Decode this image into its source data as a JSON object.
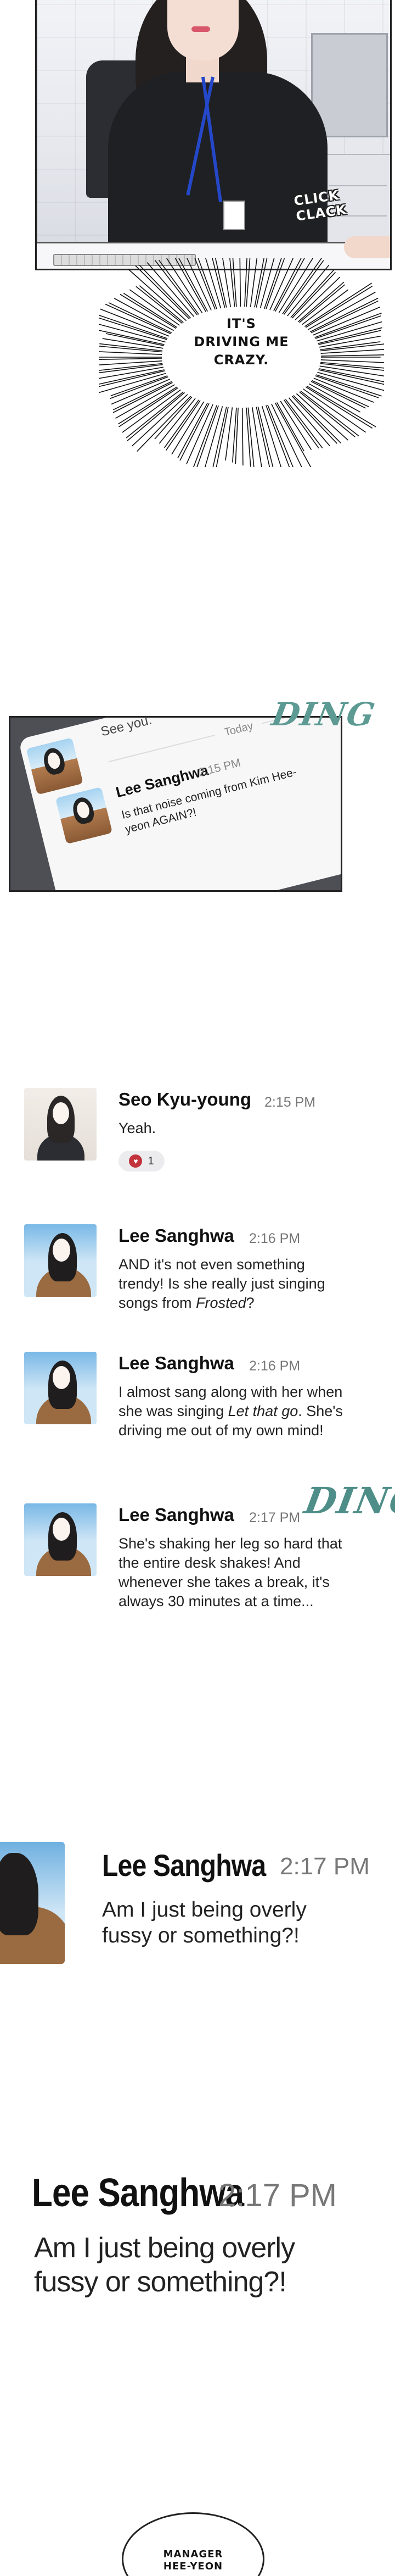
{
  "panel1": {
    "sfx": "CLICK CLACK"
  },
  "burst_bubble": {
    "line1": "IT'S",
    "line2": "DRIVING ME",
    "line3": "CRAZY."
  },
  "phone_panel": {
    "see_you": "See you.",
    "today": "Today",
    "sender": "Lee Sanghwa",
    "time": "2:15 PM",
    "message": "Is that noise coming from Kim Hee-yeon AGAIN?!",
    "sfx": "DING"
  },
  "chat": {
    "messages": [
      {
        "name": "Seo Kyu-young",
        "time": "2:15 PM",
        "text": "Yeah.",
        "reaction_count": "1"
      },
      {
        "name": "Lee Sanghwa",
        "time": "2:16 PM",
        "text_pre": "AND it's not even something trendy! Is she really just singing songs from ",
        "text_em": "Frosted",
        "text_post": "?"
      },
      {
        "name": "Lee Sanghwa",
        "time": "2:16 PM",
        "text_pre": "I almost sang along with her when she was singing ",
        "text_em": "Let that go",
        "text_post": ". She's driving me out of my own mind!"
      },
      {
        "name": "Lee Sanghwa",
        "time": "2:17 PM",
        "text": "She's shaking her leg so hard that the entire desk shakes! And whenever she takes a break, it's always 30 minutes at a time..."
      }
    ],
    "sfx": "DING"
  },
  "zoom_panel_1": {
    "name": "Lee Sanghwa",
    "time": "2:17 PM",
    "message": "Am I just being overly fussy or something?!"
  },
  "zoom_panel_2": {
    "name": "Lee Sanghwa",
    "time": "2:17 PM",
    "message": "Am I just being overly fussy or something?!"
  },
  "bottom_bubble": {
    "line1": "MANAGER",
    "line2": "HEE-YEON"
  },
  "colors": {
    "sfx_teal": "#5d9a93",
    "reaction_heart": "#c2333c",
    "lanyard": "#2448c9"
  }
}
